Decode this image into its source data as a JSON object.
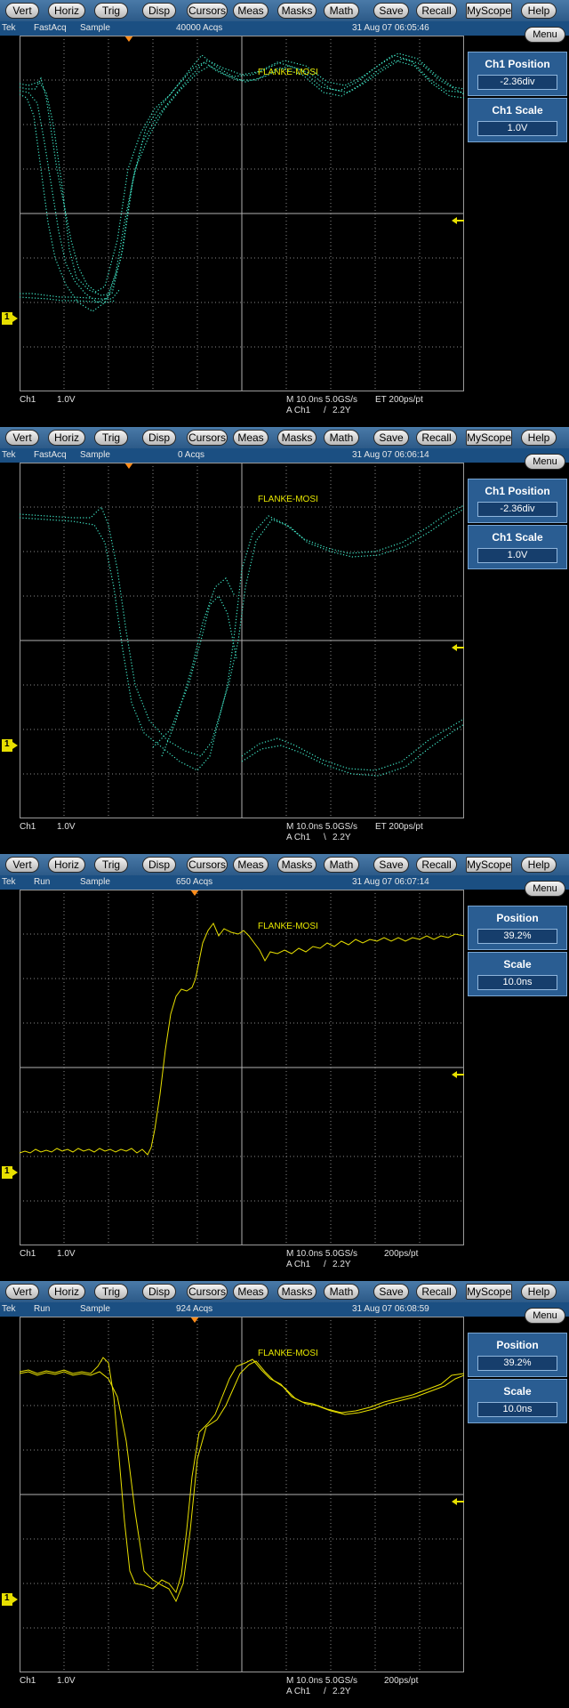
{
  "menubar": {
    "buttons": [
      "Vert",
      "Horiz",
      "Trig",
      "Disp",
      "Cursors",
      "Meas",
      "Masks",
      "Math",
      "Save",
      "Recall",
      "MyScope",
      "Help"
    ]
  },
  "menu_label": "Menu",
  "annotation": "FLANKE-MOSI",
  "channel_marker": "1",
  "colors": {
    "teal_trace": "#40e8c8",
    "yellow_trace": "#e8e000",
    "trigger_marker": "#ff8c1a",
    "panel_blue": "#2a5d92"
  },
  "screens": [
    {
      "status": {
        "brand": "Tek",
        "mode": "FastAcq",
        "acq": "Sample",
        "count": "40000 Acqs",
        "timestamp": "31 Aug 07 06:05:46"
      },
      "side": {
        "p1_title": "Ch1 Position",
        "p1_value": "-2.36div",
        "p2_title": "Ch1 Scale",
        "p2_value": "1.0V"
      },
      "readout": {
        "ch": "Ch1",
        "volts": "1.0V",
        "timebase": "M 10.0ns 5.0GS/s",
        "rate": "ET 200ps/pt",
        "trig_src": "A  Ch1",
        "trig_slope": "/",
        "trig_level": "2.2Y"
      }
    },
    {
      "status": {
        "brand": "Tek",
        "mode": "FastAcq",
        "acq": "Sample",
        "count": "0 Acqs",
        "timestamp": "31 Aug 07 06:06:14"
      },
      "side": {
        "p1_title": "Ch1 Position",
        "p1_value": "-2.36div",
        "p2_title": "Ch1 Scale",
        "p2_value": "1.0V"
      },
      "readout": {
        "ch": "Ch1",
        "volts": "1.0V",
        "timebase": "M 10.0ns 5.0GS/s",
        "rate": "ET 200ps/pt",
        "trig_src": "A  Ch1",
        "trig_slope": "\\",
        "trig_level": "2.2Y"
      }
    },
    {
      "status": {
        "brand": "Tek",
        "mode": "Run",
        "acq": "Sample",
        "count": "650 Acqs",
        "timestamp": "31 Aug 07 06:07:14"
      },
      "side": {
        "p1_title": "Position",
        "p1_value": "39.2%",
        "p2_title": "Scale",
        "p2_value": "10.0ns"
      },
      "readout": {
        "ch": "Ch1",
        "volts": "1.0V",
        "timebase": "M 10.0ns 5.0GS/s",
        "rate": "200ps/pt",
        "trig_src": "A  Ch1",
        "trig_slope": "/",
        "trig_level": "2.2Y"
      }
    },
    {
      "status": {
        "brand": "Tek",
        "mode": "Run",
        "acq": "Sample",
        "count": "924 Acqs",
        "timestamp": "31 Aug 07 06:08:59"
      },
      "side": {
        "p1_title": "Position",
        "p1_value": "39.2%",
        "p2_title": "Scale",
        "p2_value": "10.0ns"
      },
      "readout": {
        "ch": "Ch1",
        "volts": "1.0V",
        "timebase": "M 10.0ns 5.0GS/s",
        "rate": "200ps/pt",
        "trig_src": "A  Ch1",
        "trig_slope": "/",
        "trig_level": "2.2Y"
      }
    }
  ]
}
